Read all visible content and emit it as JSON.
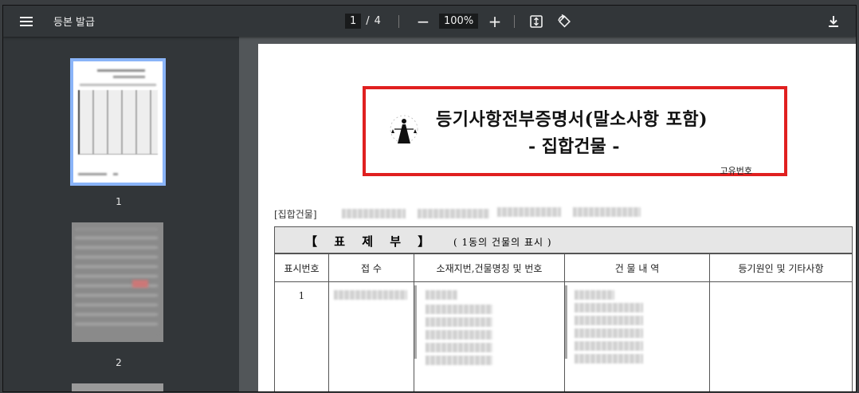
{
  "toolbar": {
    "title": "등본 발급",
    "current_page": "1",
    "page_sep": "/",
    "total_pages": "4",
    "zoom": "100%",
    "zoom_out": "−",
    "zoom_in": "+"
  },
  "sidebar": {
    "thumbnails": [
      {
        "label": "1",
        "selected": true
      },
      {
        "label": "2",
        "selected": false
      }
    ]
  },
  "document": {
    "title": "등기사항전부증명서(말소사항 포함)",
    "subtitle": "- 집합건물 -",
    "unique_no_label": "고유번호",
    "group_label": "[집합건물]",
    "section_title": "【 표 제 부 】",
    "section_sub": "( 1동의 건물의 표시 )",
    "columns": [
      "표시번호",
      "접  수",
      "소재지번,건물명칭 및 번호",
      "건 물 내 역",
      "등기원인 및 기타사항"
    ],
    "row1_no": "1"
  },
  "colors": {
    "toolbar_bg": "#323639",
    "viewer_bg": "#525659",
    "highlight_border": "#e02020",
    "thumb_selected": "#8ab4f8"
  }
}
